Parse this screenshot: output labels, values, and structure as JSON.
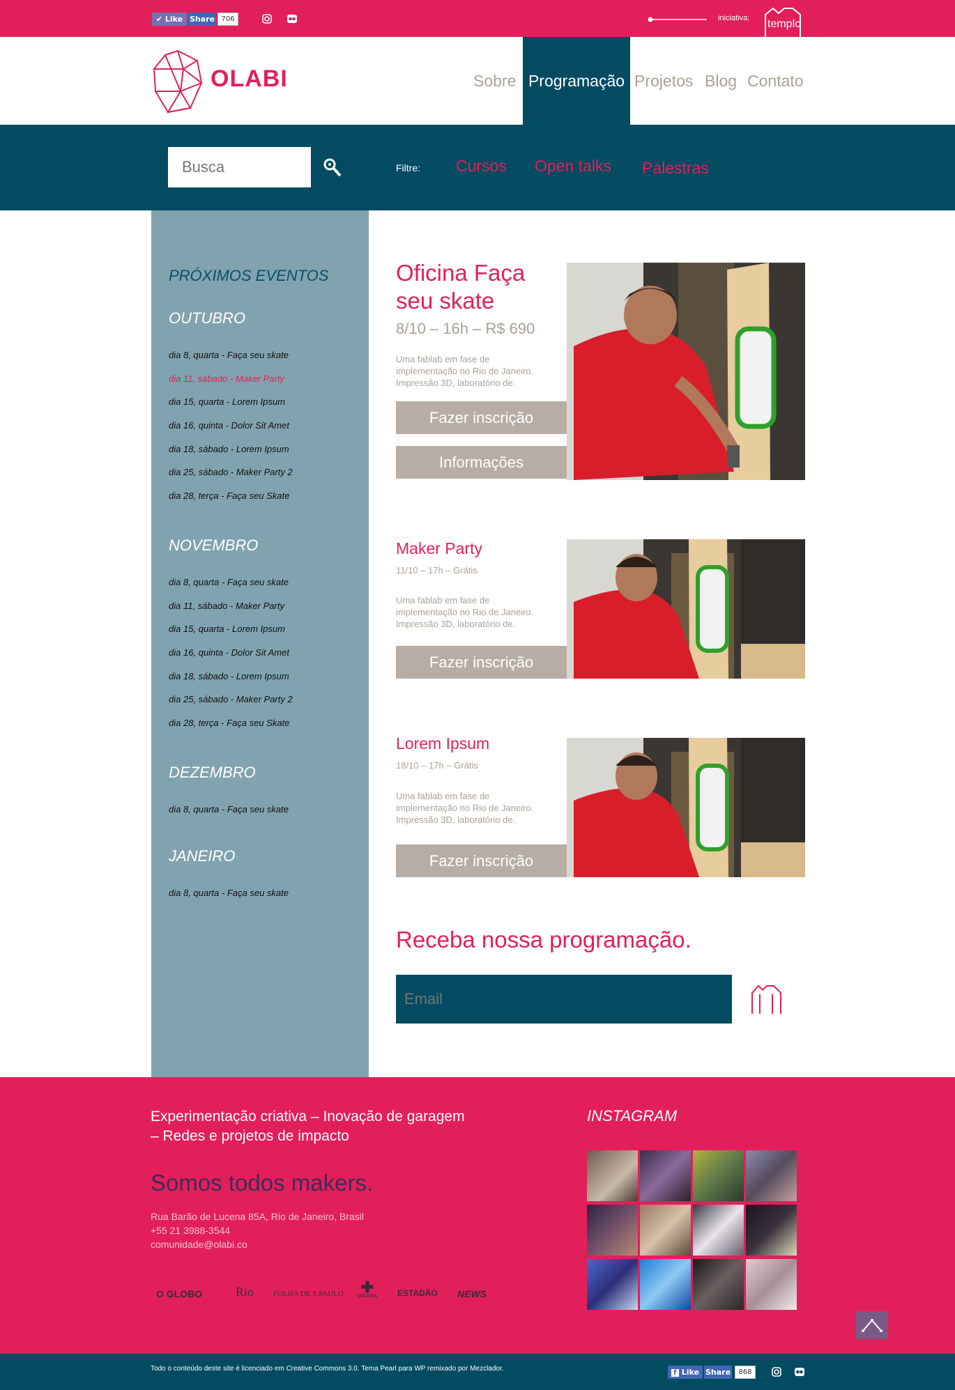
{
  "topbar": {
    "like_label": "Like",
    "share_label": "Share",
    "share_count": "706",
    "iniciativa_label": "iniciativa:",
    "templo_label": "templo",
    "icons": [
      "instagram-icon",
      "flickr-icon"
    ]
  },
  "header": {
    "logo_text": "OLABI",
    "nav": [
      {
        "label": "Sobre",
        "active": false
      },
      {
        "label": "Programação",
        "active": true
      },
      {
        "label": "Projetos",
        "active": false
      },
      {
        "label": "Blog",
        "active": false
      },
      {
        "label": "Contato",
        "active": false
      }
    ]
  },
  "filterbar": {
    "search_placeholder": "Busca",
    "filter_label": "Filtre:",
    "filters": [
      "Cursos",
      "Open talks",
      "Palestras"
    ]
  },
  "sidebar": {
    "title": "PRÓXIMOS EVENTOS",
    "months": [
      {
        "name": "OUTUBRO",
        "items": [
          {
            "text": "dia 8, quarta - Faça seu skate",
            "highlight": false
          },
          {
            "text": "dia 11, sábado - Maker Party",
            "highlight": true
          },
          {
            "text": "dia 15, quarta - Lorem Ipsum",
            "highlight": false
          },
          {
            "text": "dia 16, quinta - Dolor Sit Amet",
            "highlight": false
          },
          {
            "text": "dia 18, sábado - Lorem Ipsum",
            "highlight": false
          },
          {
            "text": "dia 25, sábado - Maker Party 2",
            "highlight": false
          },
          {
            "text": "dia 28, terça - Faça seu Skate",
            "highlight": false
          }
        ]
      },
      {
        "name": "NOVEMBRO",
        "items": [
          {
            "text": "dia 8, quarta - Faça seu skate",
            "highlight": false
          },
          {
            "text": "dia 11, sábado - Maker Party",
            "highlight": false
          },
          {
            "text": "dia 15, quarta - Lorem Ipsum",
            "highlight": false
          },
          {
            "text": "dia 16, quinta - Dolor Sit Amet",
            "highlight": false
          },
          {
            "text": "dia 18, sábado - Lorem Ipsum",
            "highlight": false
          },
          {
            "text": "dia 25, sábado - Maker Party 2",
            "highlight": false
          },
          {
            "text": "dia 28, terça - Faça seu Skate",
            "highlight": false
          }
        ]
      },
      {
        "name": "DEZEMBRO",
        "items": [
          {
            "text": "dia 8, quarta - Faça seu skate",
            "highlight": false
          }
        ]
      },
      {
        "name": "JANEIRO",
        "items": [
          {
            "text": "dia 8, quarta - Faça seu skate",
            "highlight": false
          }
        ]
      }
    ]
  },
  "events": [
    {
      "title_line1": "Oficina Faça",
      "title_line2": "seu skate",
      "meta": "8/10 – 16h – R$ 690",
      "desc_line1": "Uma fablab em fase de",
      "desc_line2": "implementação no Rio de Janeiro.",
      "desc_line3": "Impressão 3D, laboratório de.",
      "button1": "Fazer inscrição",
      "button2": "Informações"
    },
    {
      "title": "Maker Party",
      "meta": "11/10 – 17h – Grátis",
      "desc_line1": "Uma fablab em fase de",
      "desc_line2": "implementação no Rio de Janeiro.",
      "desc_line3": "Impressão 3D, laboratório de.",
      "button1": "Fazer inscrição"
    },
    {
      "title": "Lorem Ipsum",
      "meta": "18/10 – 17h – Grátis",
      "desc_line1": "Uma fablab em fase de",
      "desc_line2": "implementação no Rio de Janeiro.",
      "desc_line3": "Impressão 3D, laboratório de.",
      "button1": "Fazer inscrição"
    }
  ],
  "newsletter": {
    "title": "Receba nossa programação.",
    "email_placeholder": "Email"
  },
  "footer": {
    "tagline_line1": "Experimentação criativa – Inovação de garagem",
    "tagline_line2": "– Redes e projetos de impacto",
    "slogan": "Somos todos makers.",
    "address": "Rua Barão de Lucena 85A, Rio de Janeiro, Brasil",
    "phone": "+55 21 3988-3544",
    "email": "comunidade@olabi.co",
    "instagram_title": "INSTAGRAM",
    "press": [
      "O GLOBO",
      "Rio",
      "FOLHA DE S.PAULO",
      "CULTURA",
      "ESTADÃO",
      "NEWS"
    ]
  },
  "bottombar": {
    "license": "Todo o conteúdo deste site é licenciado em Creative Commons 3.0. Tema Pearl para WP remixado por Mezclador.",
    "like_label": "Like",
    "share_label": "Share",
    "share_count": "868"
  },
  "colors": {
    "brand_pink": "#e21f5b",
    "dark_teal": "#024b61",
    "sidebar_blue": "#80a3af",
    "button_taupe": "#b7ada4"
  }
}
